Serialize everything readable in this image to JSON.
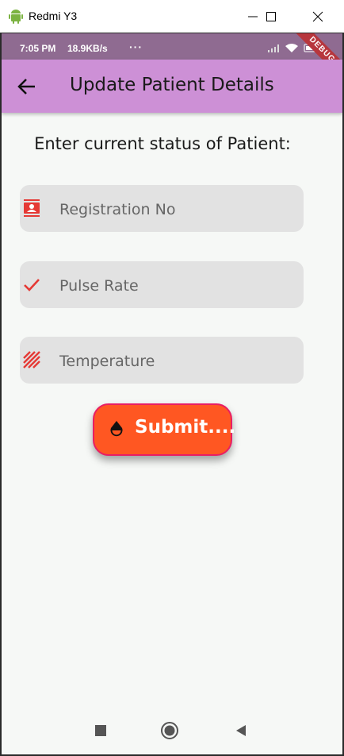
{
  "window": {
    "title": "Redmi Y3"
  },
  "status_bar": {
    "time": "7:05 PM",
    "speed": "18.9KB/s",
    "more": "···",
    "debug": "DEBUG"
  },
  "app_bar": {
    "title": "Update Patient Details"
  },
  "form": {
    "heading": "Enter current status of Patient:",
    "fields": [
      {
        "placeholder": "Registration No",
        "icon": "badge-icon",
        "value": ""
      },
      {
        "placeholder": "Pulse Rate",
        "icon": "check-icon",
        "value": ""
      },
      {
        "placeholder": "Temperature",
        "icon": "stripes-icon",
        "value": ""
      }
    ],
    "submit_label": "Submit...."
  },
  "colors": {
    "app_bar": "#cd90d6",
    "status_bar": "#8f6b91",
    "field_bg": "#e2e2e2",
    "icon_red": "#e53935",
    "submit_bg": "#ff5722",
    "submit_border": "#e91e63"
  }
}
